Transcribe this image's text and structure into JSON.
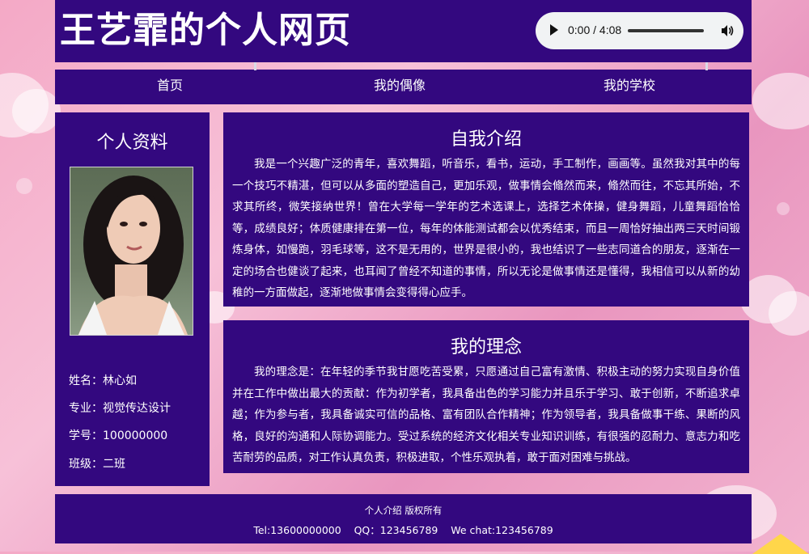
{
  "header": {
    "title": "王艺霏的个人网页",
    "audio": {
      "time": "0:00 / 4:08",
      "progress": 0
    }
  },
  "nav": {
    "items": [
      {
        "label": "首页"
      },
      {
        "label": "我的偶像"
      },
      {
        "label": "我的学校"
      }
    ]
  },
  "sidebar": {
    "title": "个人资料",
    "photo_icon": "person-portrait",
    "info": [
      {
        "text": "姓名：林心如"
      },
      {
        "text": "专业：视觉传达设计"
      },
      {
        "text": "学号：100000000"
      },
      {
        "text": "班级：二班"
      }
    ]
  },
  "intro": {
    "title": "自我介绍",
    "text": "我是一个兴趣广泛的青年，喜欢舞蹈，听音乐，看书，运动，手工制作，画画等。虽然我对其中的每一个技巧不精湛，但可以从多面的塑造自己，更加乐观，做事情会翛然而来，翛然而往，不忘其所始，不求其所终，微笑接纳世界！曾在大学每一学年的艺术选课上，选择艺术体操，健身舞蹈，儿童舞蹈恰恰等，成绩良好；体质健康排在第一位，每年的体能测试都会以优秀结束，而且一周恰好抽出两三天时间锻炼身体，如慢跑，羽毛球等，这不是无用的，世界是很小的，我也结识了一些志同道合的朋友，逐渐在一定的场合也健谈了起来，也耳闻了曾经不知道的事情，所以无论是做事情还是懂得，我相信可以从新的幼稚的一方面做起，逐渐地做事情会变得得心应手。"
  },
  "belief": {
    "title": "我的理念",
    "text": "我的理念是：在年轻的季节我甘愿吃苦受累，只愿通过自己富有激情、积极主动的努力实现自身价值并在工作中做出最大的贡献：作为初学者，我具备出色的学习能力并且乐于学习、敢于创新，不断追求卓越；作为参与者，我具备诚实可信的品格、富有团队合作精神；作为领导者，我具备做事干练、果断的风格，良好的沟通和人际协调能力。受过系统的经济文化相关专业知识训练，有很强的忍耐力、意志力和吃苦耐劳的品质，对工作认真负责，积极进取，个性乐观执着，敢于面对困难与挑战。"
  },
  "footer": {
    "copyright": "个人介绍 版权所有",
    "contact": "Tel:13600000000    QQ：123456789    We chat:123456789"
  },
  "colors": {
    "panel": "#33087f",
    "background": "#f4a9c6",
    "text": "#ffffff"
  }
}
